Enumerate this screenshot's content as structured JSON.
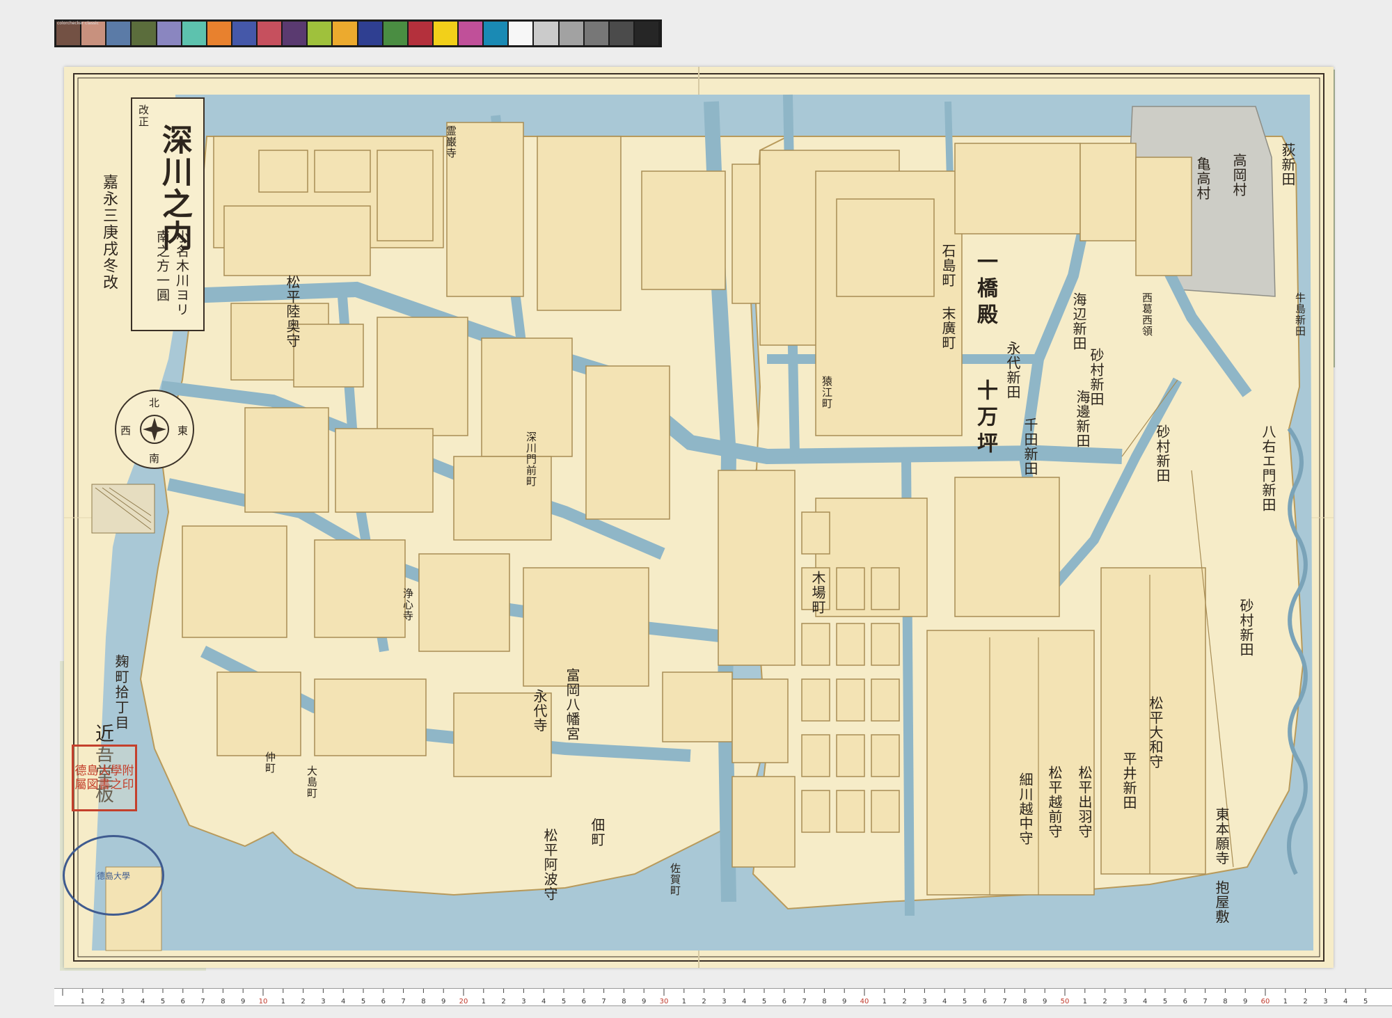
{
  "checker": {
    "label": "colorchecker classic",
    "swatches": [
      "#735144",
      "#c8917e",
      "#5b7ba7",
      "#5b6d3c",
      "#8a86c0",
      "#5dc2ae",
      "#e8812e",
      "#4558a9",
      "#c6505e",
      "#5a3a70",
      "#9fc13c",
      "#ecaa2e",
      "#2f3f91",
      "#4a8d42",
      "#b4303c",
      "#f2d01a",
      "#c05099",
      "#1a8ab4",
      "#f7f7f7",
      "#cbcbcb",
      "#a2a2a2",
      "#777777",
      "#4b4b4b",
      "#262626"
    ]
  },
  "title": {
    "prefix": "改正",
    "main": "深川之内",
    "sub_1": "小名木川ヨリ",
    "sub_2": "南之方一圓",
    "edition": "嘉永三庚戌冬改"
  },
  "publisher": {
    "line_1": "麹町拾丁目",
    "line_2": "近吾堂板"
  },
  "compass": {
    "north": "北",
    "south": "南",
    "east": "東",
    "west": "西"
  },
  "seals": {
    "red": "德島大學附屬図書之印",
    "blue": "德島大學"
  },
  "labels": {
    "hitotsubashi": "一橋殿",
    "jumanbo": "十万坪",
    "ishijima": "石島町",
    "suehiro": "末廣町",
    "sunamura_1": "砂村新田",
    "sunamura_2": "砂村新田",
    "sunamura_3": "砂村新田",
    "kaibe_1": "海辺新田",
    "kaibe_2": "海邊新田",
    "eitai": "永代新田",
    "senda": "千田新田",
    "higashi_honganji": "東本願寺",
    "shimoyashiki": "抱屋敷",
    "matsudaira_1": "松平大和守",
    "matsudaira_2": "松平出羽守",
    "matsudaira_3": "松平越前守",
    "matsudaira_4": "松平阿波守",
    "matsudaira_5": "松平陸奥守",
    "hosokawa": "細川越中守",
    "kiba": "木場町",
    "sarue": "猿江町",
    "fukagawa_mon": "深川門前町",
    "tomioka": "富岡八幡宮",
    "hachiemon": "八右エ門新田",
    "hiragi": "平井新田",
    "tsukuda": "佃町",
    "nakachō": "仲町",
    "ōshima": "大島町",
    "saga": "佐賀町",
    "eitaiji": "永代寺",
    "reiganji": "霊巌寺",
    "jōshinji": "浄心寺",
    "ushijima": "牛島新田",
    "kasai_nishi": "西葛西領",
    "takaoka": "高岡村",
    "ogi": "荻新田",
    "kōtō": "亀高村"
  },
  "ruler": {
    "major": [
      "10",
      "20",
      "30",
      "40",
      "50",
      "60"
    ],
    "minor": [
      "1",
      "2",
      "3",
      "4",
      "5",
      "6",
      "7",
      "8",
      "9"
    ]
  }
}
